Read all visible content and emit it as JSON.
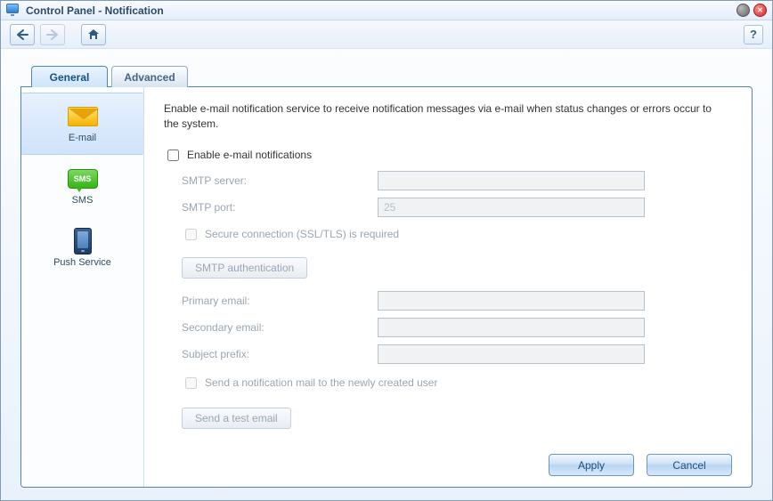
{
  "title": "Control Panel - Notification",
  "tabs": {
    "general": "General",
    "advanced": "Advanced"
  },
  "sidenav": {
    "email": "E-mail",
    "sms": "SMS",
    "push": "Push Service",
    "sms_icon_text": "SMS"
  },
  "intro": "Enable e-mail notification service to receive notification messages via e-mail when status changes or errors occur to the system.",
  "form": {
    "enable_label": "Enable e-mail notifications",
    "smtp_server_label": "SMTP server:",
    "smtp_server_value": "",
    "smtp_port_label": "SMTP port:",
    "smtp_port_placeholder": "25",
    "ssl_label": "Secure connection (SSL/TLS) is required",
    "smtp_auth_btn": "SMTP authentication",
    "primary_label": "Primary email:",
    "primary_value": "",
    "secondary_label": "Secondary email:",
    "secondary_value": "",
    "subject_prefix_label": "Subject prefix:",
    "subject_prefix_value": "",
    "send_new_user_label": "Send a notification mail to the newly created user",
    "test_email_btn": "Send a test email"
  },
  "footer": {
    "apply": "Apply",
    "cancel": "Cancel"
  },
  "help_symbol": "?"
}
